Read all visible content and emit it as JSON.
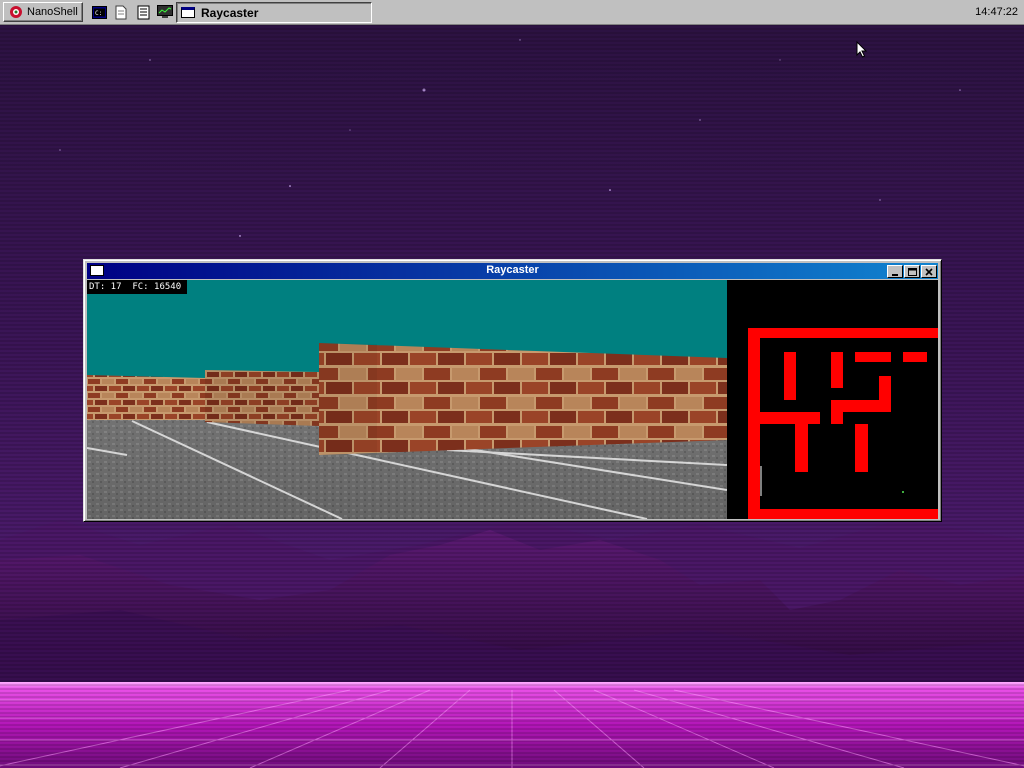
{
  "taskbar": {
    "start_label": "NanoShell",
    "task_title": "Raycaster",
    "clock": "14:47:22",
    "quick_launch": [
      "terminal-icon",
      "document-icon",
      "notepad-icon",
      "monitor-icon"
    ]
  },
  "window": {
    "title": "Raycaster",
    "hud_text": "DT: 17  FC: 16540"
  },
  "colors": {
    "taskbar": "#c0c0c0",
    "titlebar_start": "#000084",
    "titlebar_end": "#1084d0",
    "sky": "#008080",
    "minimap_wall": "#ff0000",
    "brick": "#8e3b22"
  }
}
